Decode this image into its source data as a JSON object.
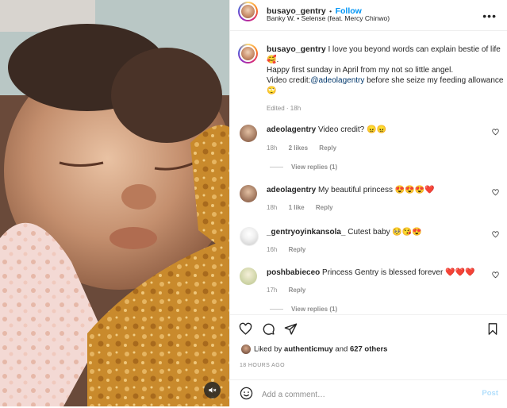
{
  "post": {
    "username": "busayo_gentry",
    "follow_label": "Follow",
    "separator": "•",
    "audio": "Banky W. • Selense (feat. Mercy Chinwo)",
    "more_label": "•••"
  },
  "caption": {
    "username": "busayo_gentry",
    "line1": "I love you beyond words can explain bestie of life 🥰.",
    "line2": "Happy first sunday in April from my not so little angel.",
    "line3_prefix": "Video credit:",
    "mention": "@adeolagentry",
    "line3_suffix": " before she seize my feeding allowance 🙄",
    "edited": "Edited · 18h"
  },
  "comments": [
    {
      "username": "adeolagentry",
      "text": "Video credit? 😠😠",
      "age": "18h",
      "likes": "2 likes",
      "reply": "Reply",
      "view_replies": "View replies (1)"
    },
    {
      "username": "adeolagentry",
      "text": "My beautiful princess 😍😍😍❤️",
      "age": "18h",
      "likes": "1 like",
      "reply": "Reply",
      "view_replies": ""
    },
    {
      "username": "_gentryoyinkansola_",
      "text": "Cutest baby 🥺😘😍",
      "age": "16h",
      "likes": "",
      "reply": "Reply",
      "view_replies": ""
    },
    {
      "username": "poshbabieceo",
      "text": "Princess Gentry is blessed forever ❤️❤️❤️",
      "age": "17h",
      "likes": "",
      "reply": "Reply",
      "view_replies": "View replies (1)"
    }
  ],
  "likes": {
    "prefix": "Liked by ",
    "user": "authenticmuy",
    "middle": " and ",
    "others": "627 others"
  },
  "time_ago": "18 HOURS AGO",
  "composer": {
    "placeholder": "Add a comment…",
    "post_label": "Post"
  },
  "icons": [
    "mute-icon",
    "more-icon",
    "heart-icon",
    "comment-icon",
    "share-icon",
    "bookmark-icon",
    "emoji-icon"
  ],
  "colors": {
    "accent": "#0095f6",
    "mention": "#00376b",
    "muted": "#8e8e8e",
    "post_disabled": "#b2dffc"
  }
}
